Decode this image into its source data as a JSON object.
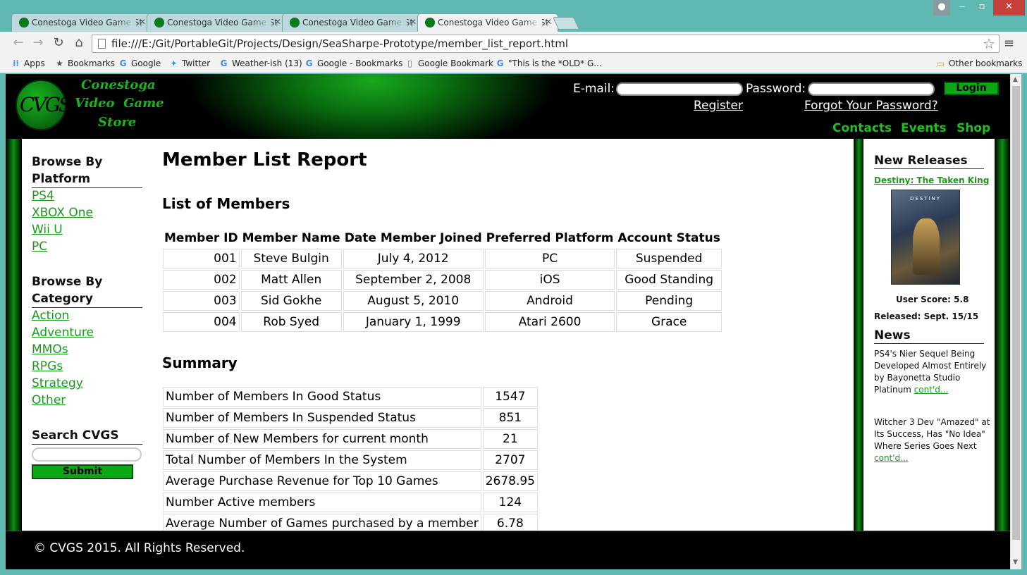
{
  "browser": {
    "tabs": [
      {
        "label": "Conestoga Video Game St"
      },
      {
        "label": "Conestoga Video Game St"
      },
      {
        "label": "Conestoga Video Game St"
      },
      {
        "label": "Conestoga Video Game St"
      }
    ],
    "url": "file:///E:/Git/PortableGit/Projects/Design/SeaSharpe-Prototype/member_list_report.html",
    "bookmarks": [
      {
        "label": "Apps",
        "icon": "apps-grid-icon"
      },
      {
        "label": "Bookmarks",
        "icon": "star-icon"
      },
      {
        "label": "Google",
        "icon": "google-icon"
      },
      {
        "label": "Twitter",
        "icon": "twitter-icon"
      },
      {
        "label": "Weather-ish (13)",
        "icon": "google-icon"
      },
      {
        "label": "Google - Bookmarks",
        "icon": "google-icon"
      },
      {
        "label": "Google Bookmark",
        "icon": "page-icon"
      },
      {
        "label": "\"This is the *OLD* G...",
        "icon": "google-icon"
      }
    ],
    "other_bookmarks": "Other bookmarks"
  },
  "header": {
    "logo_text": "CVGS",
    "logo_lines": [
      "Conestoga",
      "Video  Game",
      "Store"
    ],
    "email_label": "E-mail:",
    "password_label": "Password:",
    "login_label": "Login",
    "register_label": "Register",
    "forgot_label": "Forgot Your Password?",
    "nav": [
      "Contacts",
      "Events",
      "Shop"
    ]
  },
  "left_sidebar": {
    "platform_heading": "Browse By Platform",
    "platforms": [
      "PS4",
      "XBOX One",
      "Wii U",
      "PC"
    ],
    "category_heading": "Browse By Category",
    "categories": [
      "Action",
      "Adventure",
      "MMOs",
      "RPGs",
      "Strategy",
      "Other"
    ],
    "search_heading": "Search CVGS",
    "submit_label": "Submit"
  },
  "main": {
    "title": "Member List Report",
    "members_heading": "List of Members",
    "members_columns": [
      "Member ID",
      "Member Name",
      "Date Member Joined",
      "Preferred Platform",
      "Account Status"
    ],
    "members_rows": [
      [
        "001",
        "Steve Bulgin",
        "July 4, 2012",
        "PC",
        "Suspended"
      ],
      [
        "002",
        "Matt Allen",
        "September 2, 2008",
        "iOS",
        "Good Standing"
      ],
      [
        "003",
        "Sid Gokhe",
        "August 5, 2010",
        "Android",
        "Pending"
      ],
      [
        "004",
        "Rob Syed",
        "January 1, 1999",
        "Atari 2600",
        "Grace"
      ]
    ],
    "summary_heading": "Summary",
    "summary_rows": [
      [
        "Number of Members In Good Status",
        "1547"
      ],
      [
        "Number of Members In Suspended Status",
        "851"
      ],
      [
        "Number of New Members for current month",
        "21"
      ],
      [
        "Total Number of Members In the System",
        "2707"
      ],
      [
        "Average Purchase Revenue for Top 10 Games",
        "2678.95"
      ],
      [
        "Number Active members",
        "124"
      ],
      [
        "Average Number of Games purchased by a member",
        "6.78"
      ]
    ]
  },
  "right_sidebar": {
    "new_releases_heading": "New Releases",
    "game_title": "Destiny: The Taken King",
    "cover_text": "DESTINY",
    "user_score": "User Score: 5.8",
    "released": "Released: Sept. 15/15",
    "news_heading": "News",
    "news": [
      {
        "text": "PS4's Nier Sequel Being Developed Almost Entirely by Bayonetta Studio Platinum ",
        "link": "cont'd..."
      },
      {
        "text": "Witcher 3 Dev \"Amazed\" at Its Success, Has \"No Idea\" Where Series Goes Next ",
        "link": "cont'd..."
      }
    ]
  },
  "footer": {
    "text": "© CVGS 2015. All Rights Reserved."
  },
  "colors": {
    "brand_green": "#0aa814",
    "link_green": "#1a9a1a",
    "chrome_frame": "#5fb8b2"
  }
}
